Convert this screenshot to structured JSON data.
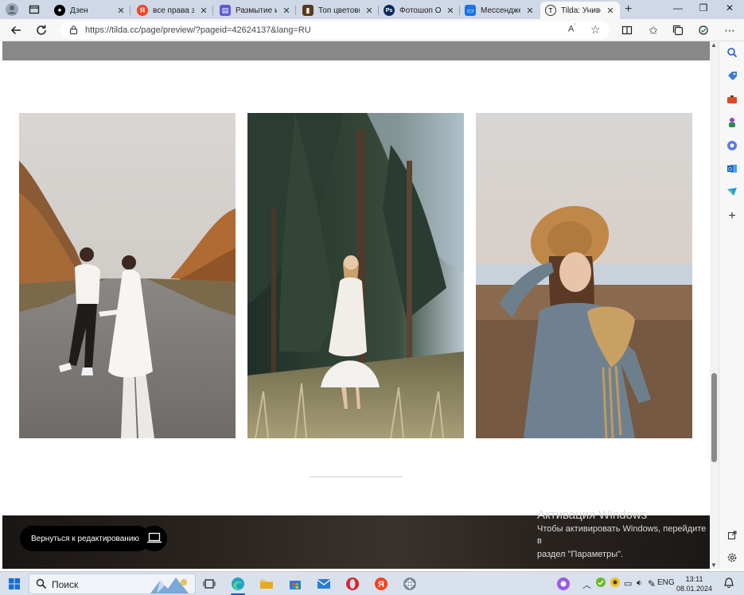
{
  "tabs": [
    {
      "title": "Дзен",
      "favicon": "dzen-icon",
      "color": "#000000"
    },
    {
      "title": "все права защ",
      "favicon": "yandex-icon",
      "color": "#fc3f1d"
    },
    {
      "title": "Размытие изо",
      "favicon": "blur-site-icon",
      "color": "#5b5bd6"
    },
    {
      "title": "Топ цветовых",
      "favicon": "bookmark-icon",
      "color": "#5a3a1a"
    },
    {
      "title": "Фотошоп Онл",
      "favicon": "photoshop-icon",
      "color": "#0b2a5b"
    },
    {
      "title": "Мессенджер",
      "favicon": "messenger-icon",
      "color": "#1a73e8"
    },
    {
      "title": "Tilda: Универ",
      "favicon": "tilda-icon",
      "color": "#333333"
    }
  ],
  "address": {
    "url": "https://tilda.cc/page/preview/?pageid=42624137&lang=RU"
  },
  "page": {
    "back_button": "Вернуться к редактированию",
    "watermark_title": "Активация Windows",
    "watermark_text_1": "Чтобы активировать Windows, перейдите в",
    "watermark_text_2": "раздел \"Параметры\"."
  },
  "taskbar": {
    "search_label": "Поиск",
    "language": "ENG",
    "time": "13:11",
    "date": "08.01.2024"
  },
  "colors": {
    "accent": "#0067c0",
    "tabstrip": "#cfd8e6",
    "taskbar": "#d9e1ec"
  }
}
